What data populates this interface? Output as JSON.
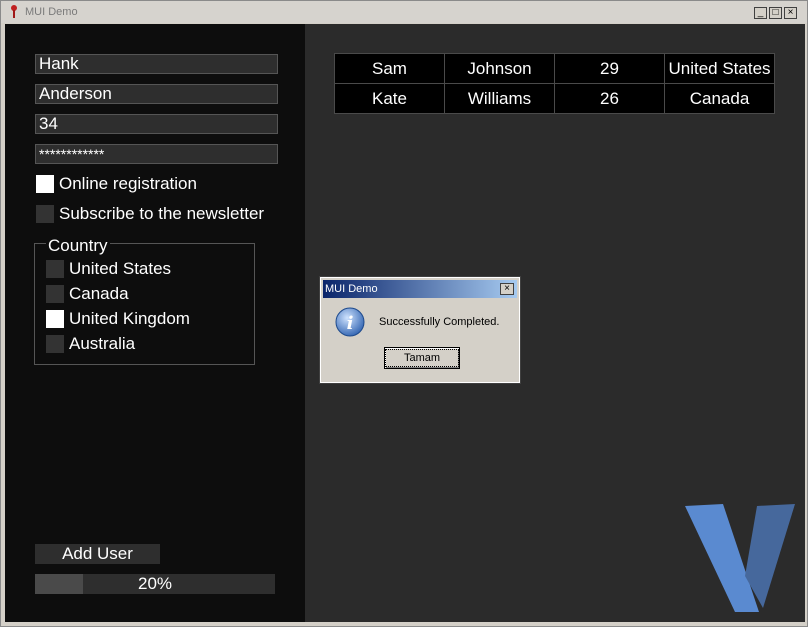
{
  "window": {
    "title": "MUI Demo",
    "minimize_glyph": "_",
    "maximize_glyph": "□",
    "close_glyph": "×"
  },
  "form": {
    "first_name": "Hank",
    "last_name": "Anderson",
    "age": "34",
    "password": "************",
    "online_registration_label": "Online registration",
    "online_registration_checked": true,
    "newsletter_label": "Subscribe to the newsletter",
    "newsletter_checked": false,
    "country": {
      "title": "Country",
      "options": [
        {
          "label": "United States",
          "checked": false
        },
        {
          "label": "Canada",
          "checked": false
        },
        {
          "label": "United Kingdom",
          "checked": true
        },
        {
          "label": "Australia",
          "checked": false
        }
      ]
    },
    "add_user_label": "Add User",
    "progress_text": "20%",
    "progress_value": 0.2
  },
  "table": {
    "rows": [
      [
        "Sam",
        "Johnson",
        "29",
        "United States"
      ],
      [
        "Kate",
        "Williams",
        "26",
        "Canada"
      ]
    ]
  },
  "dialog": {
    "title": "MUI Demo",
    "message": "Successfully Completed.",
    "ok_label": "Tamam",
    "close_glyph": "×",
    "info_glyph": "i"
  },
  "colors": {
    "left_pane": "#0d0d0d",
    "right_pane": "#2b2b2b",
    "logo": "#4f7fbf"
  },
  "icons": {
    "app": "app-icon",
    "dialog": "information-icon",
    "logo": "v-logo-icon"
  }
}
